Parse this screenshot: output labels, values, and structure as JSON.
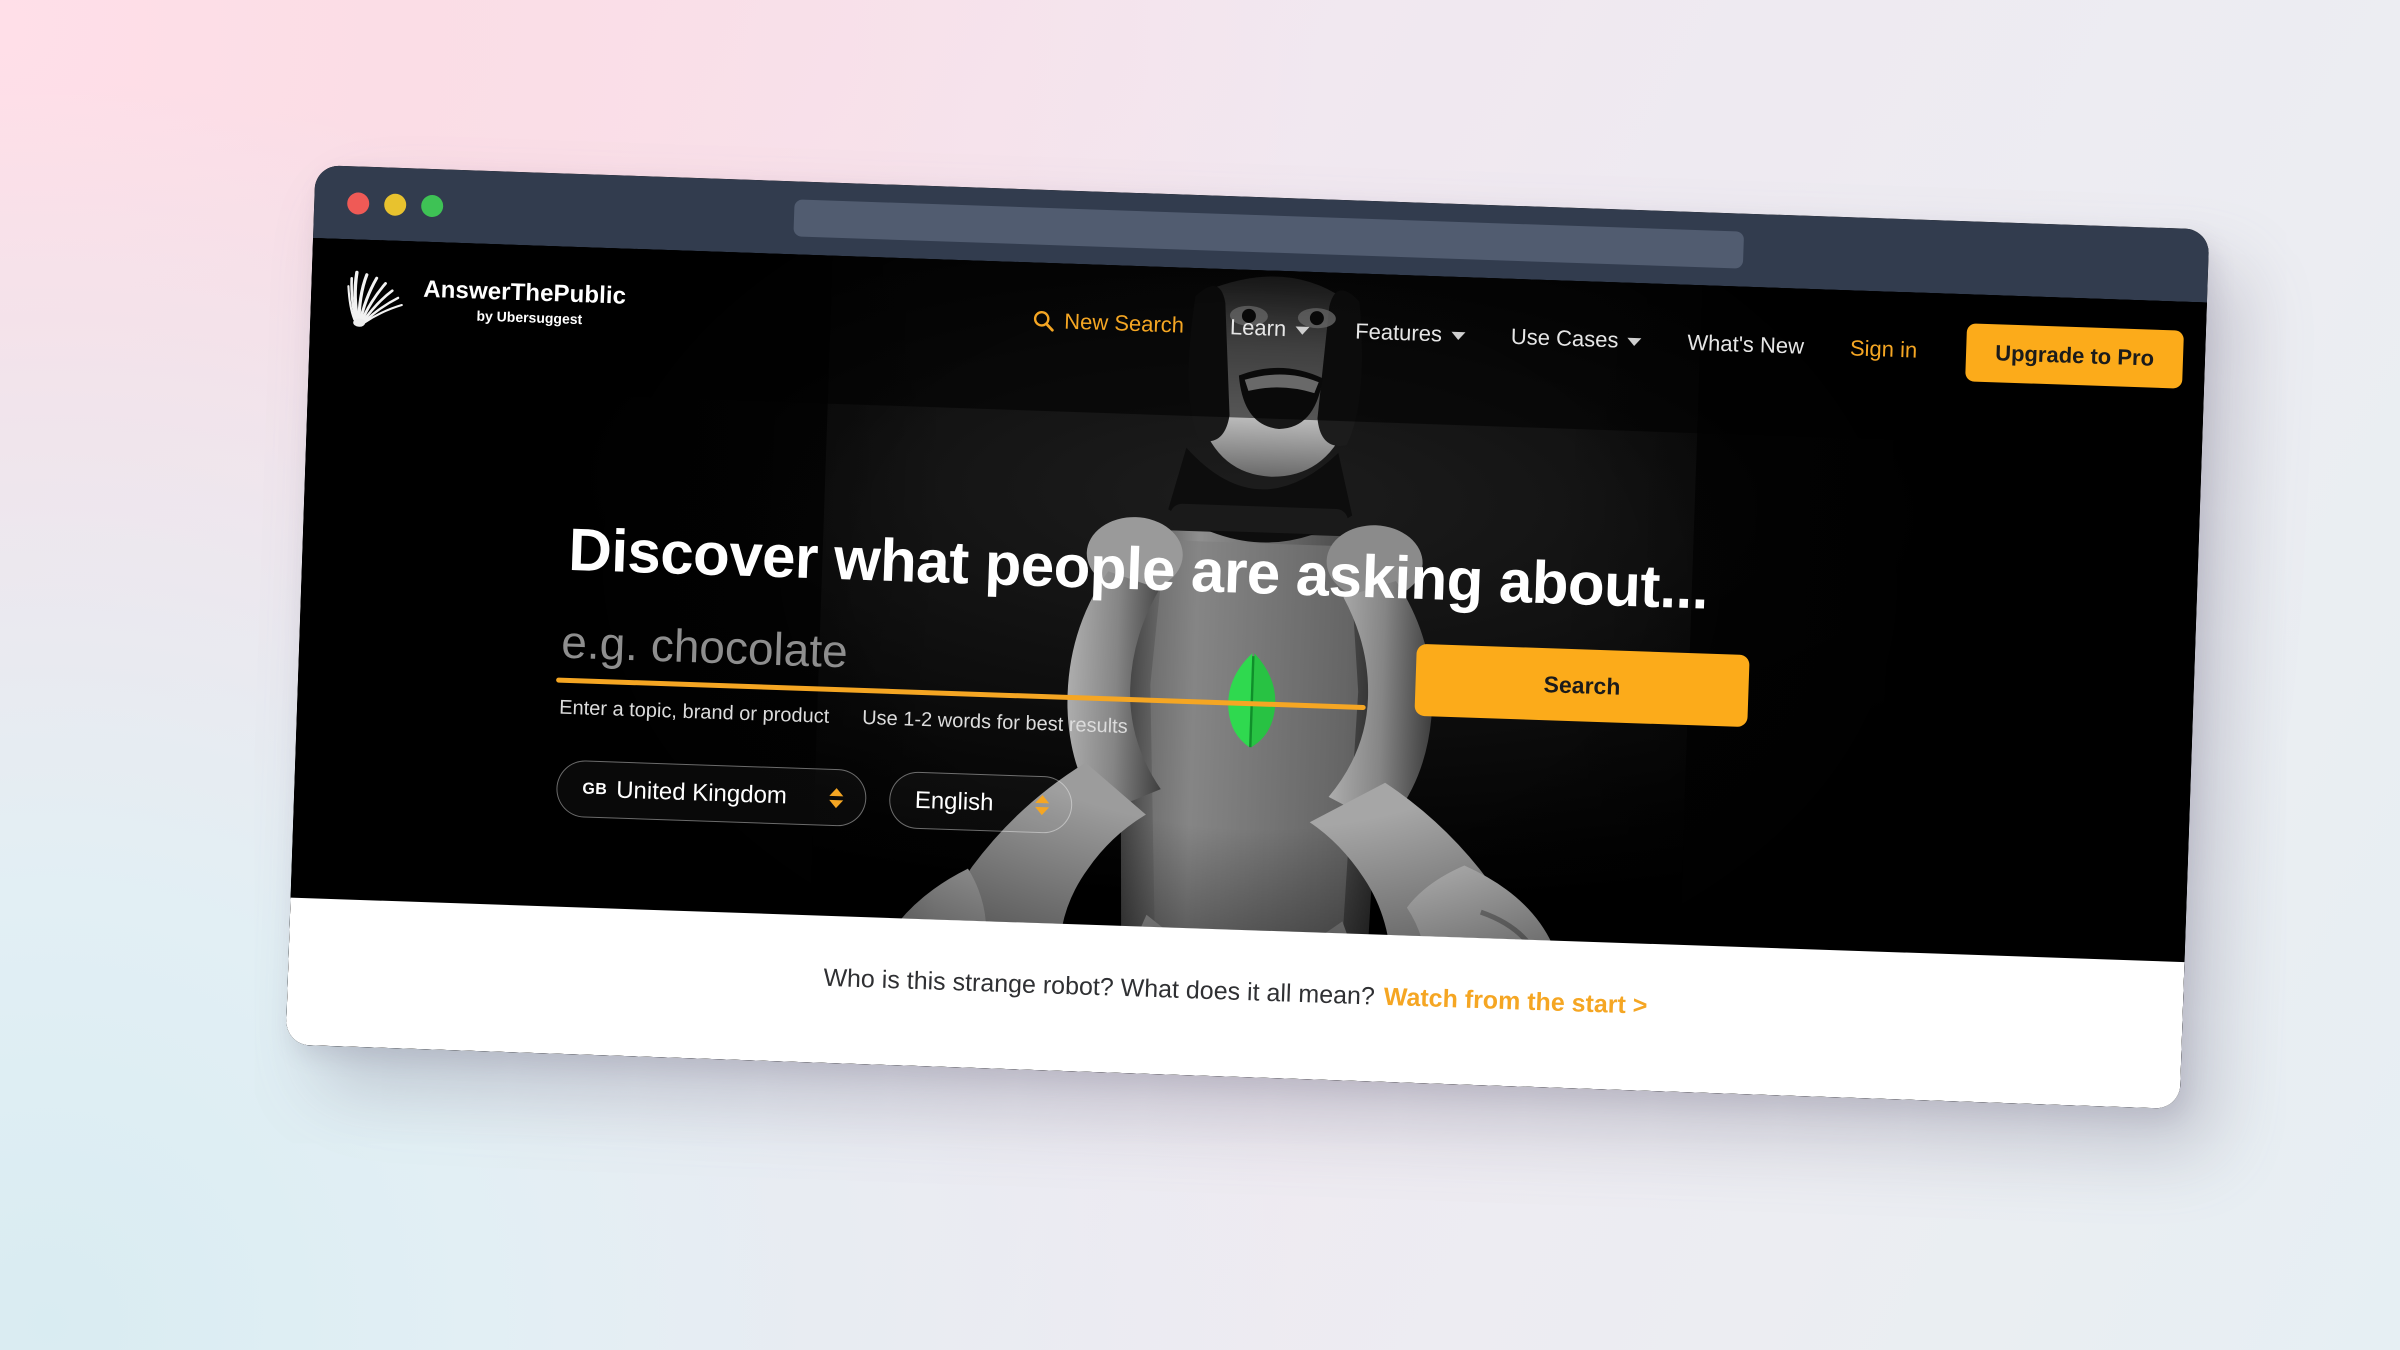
{
  "browser": {
    "traffic_lights": [
      "close-red",
      "minimize-yellow",
      "maximize-green"
    ],
    "url_bar_value": "",
    "url_bar_placeholder": ""
  },
  "brand": {
    "title": "AnswerThePublic",
    "subtitle": "by Ubersuggest",
    "mark_icon": "fan-burst-logo-icon"
  },
  "nav": {
    "items": [
      {
        "label": "New Search",
        "icon": "search-icon",
        "accent": true,
        "caret": false
      },
      {
        "label": "Learn",
        "icon": "",
        "accent": false,
        "caret": true
      },
      {
        "label": "Features",
        "icon": "",
        "accent": false,
        "caret": true
      },
      {
        "label": "Use Cases",
        "icon": "",
        "accent": false,
        "caret": true
      },
      {
        "label": "What's New",
        "icon": "",
        "accent": false,
        "caret": false
      },
      {
        "label": "Sign in",
        "icon": "",
        "accent": true,
        "caret": false
      }
    ],
    "upgrade_label": "Upgrade to Pro"
  },
  "hero": {
    "headline": "Discover what people are asking about...",
    "search_value": "",
    "search_placeholder": "e.g. chocolate",
    "hint_left": "Enter a topic, brand or product",
    "hint_right": "Use 1-2 words for best results",
    "search_button_label": "Search",
    "country_code": "GB",
    "country_label": "United Kingdom",
    "language_label": "English"
  },
  "caption": {
    "text": "Who is this strange robot? What does it all mean?",
    "link_label": "Watch from the start >"
  },
  "colors": {
    "accent_orange": "#f5a623",
    "button_orange": "#fcab1a",
    "titlebar_slate": "#323c4e",
    "urlbar_slate": "#515c70",
    "page_black": "#000000",
    "caption_white": "#ffffff",
    "light_red": "#ef5a56",
    "light_yellow": "#e8c22e",
    "light_green": "#3ec255",
    "leaf_green": "#2fd94f",
    "backdrop_pink": "#fbdde7",
    "backdrop_blue": "#e2eff4"
  }
}
